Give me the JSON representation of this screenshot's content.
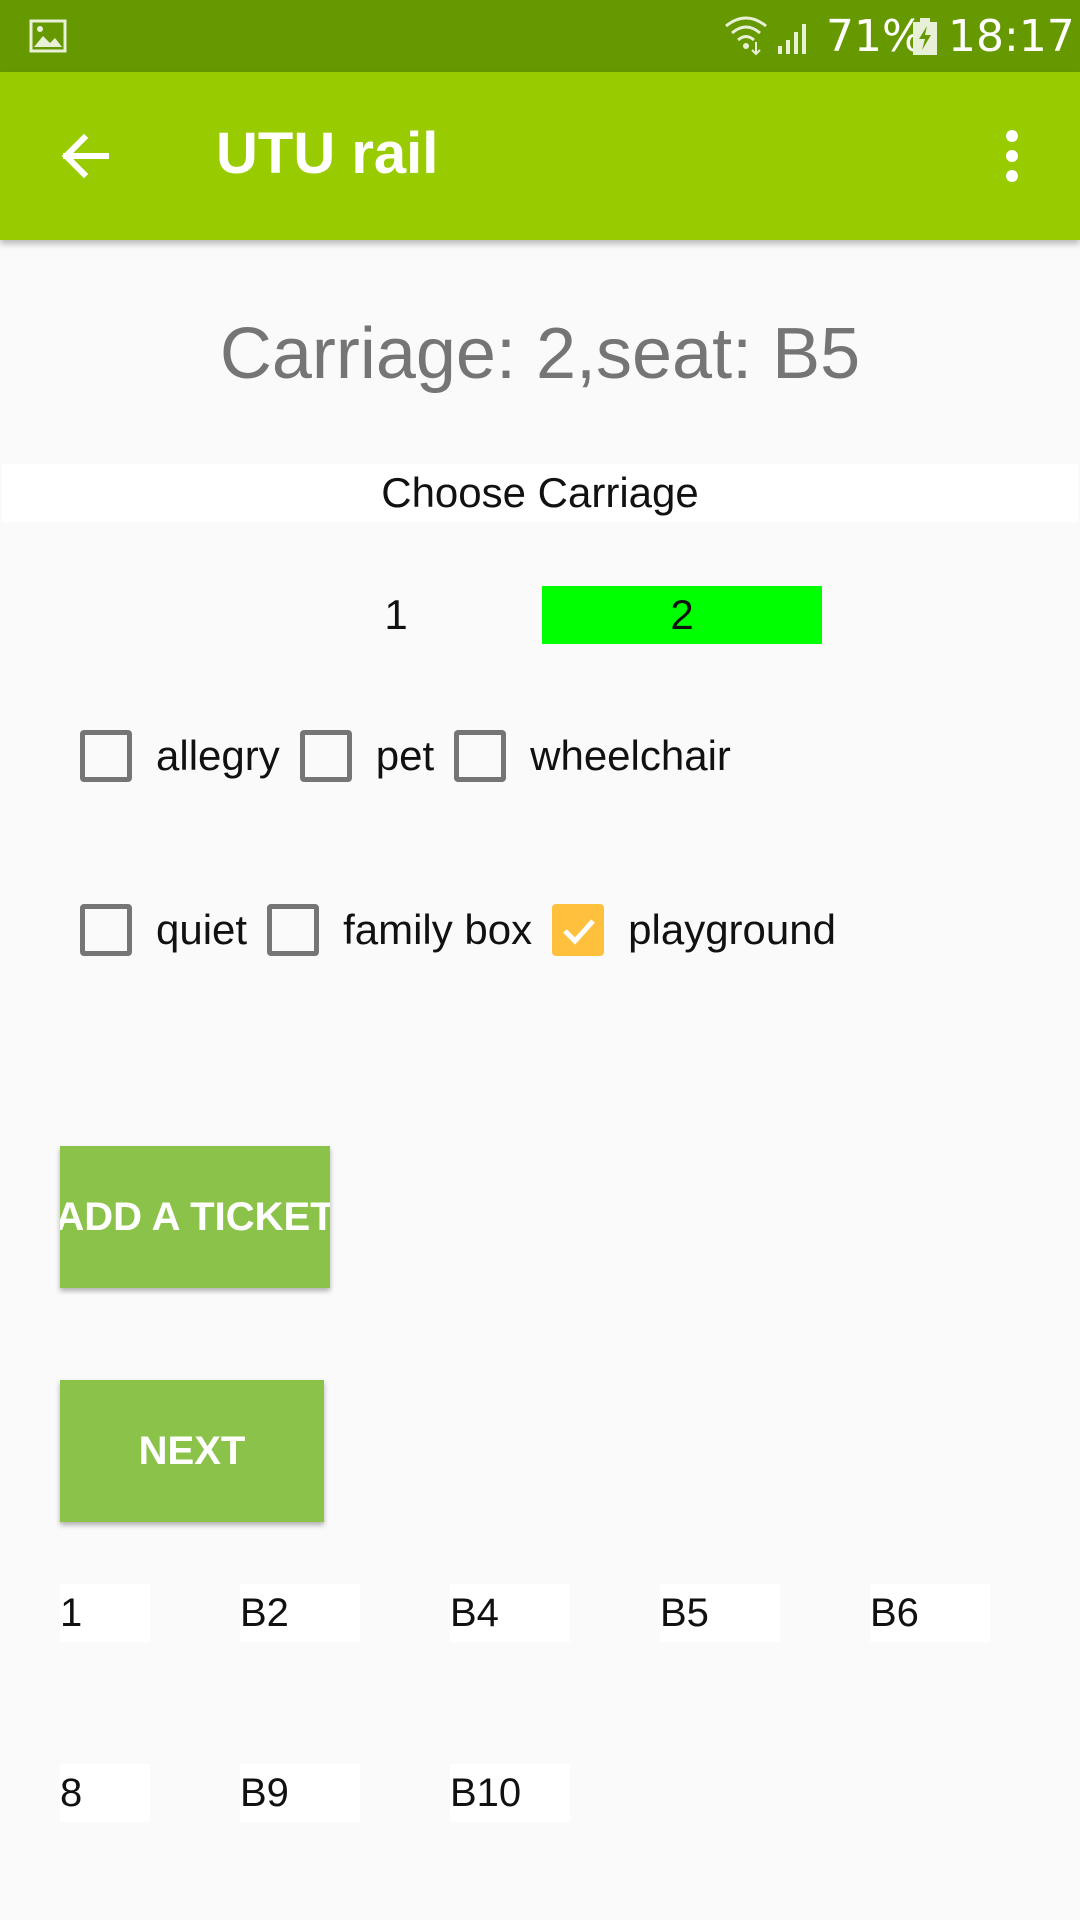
{
  "status_bar": {
    "battery": "71%",
    "time": "18:17"
  },
  "app_bar": {
    "title": "UTU rail"
  },
  "selection_heading": "Carriage: 2,seat: B5",
  "choose_label": "Choose Carriage",
  "carriages": [
    "1",
    "2"
  ],
  "selected_carriage": "2",
  "options_row1": [
    {
      "label": "allegry",
      "checked": false
    },
    {
      "label": "pet",
      "checked": false
    },
    {
      "label": "wheelchair",
      "checked": false
    }
  ],
  "options_row2": [
    {
      "label": "quiet",
      "checked": false
    },
    {
      "label": "family box",
      "checked": false
    },
    {
      "label": "playground",
      "checked": true
    }
  ],
  "buttons": {
    "add_ticket": "ADD A TICKET",
    "next": "NEXT"
  },
  "seats_row1": [
    "1",
    "B2",
    "B4",
    "B5",
    "B6"
  ],
  "seats_row2": [
    "8",
    "B9",
    "B10"
  ],
  "colors": {
    "status_bar": "#669900",
    "app_bar": "#99cc00",
    "selected_carriage": "#00ff00",
    "buttons": "#8bc34a",
    "checkbox_checked": "#ffc03d"
  }
}
